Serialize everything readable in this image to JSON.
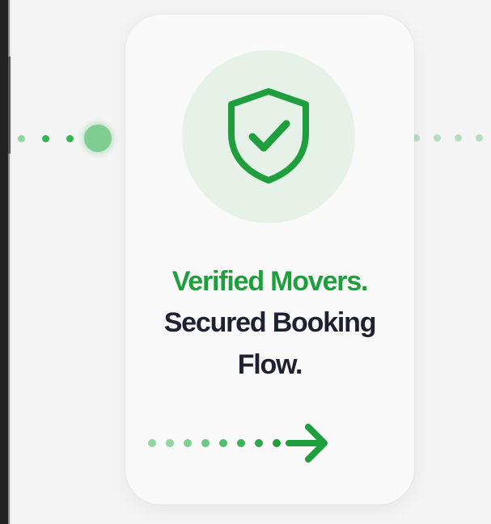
{
  "card": {
    "icon": "shield-check-icon",
    "headline_green": "Verified Movers.",
    "headline_line2": "Secured Booking",
    "headline_line3": "Flow.",
    "next_icon": "arrow-right-icon"
  },
  "colors": {
    "accent_green": "#1f9e3d",
    "text_dark": "#1e2230",
    "badge_bg": "#e6f2e8",
    "background": "#f4f4f4"
  }
}
